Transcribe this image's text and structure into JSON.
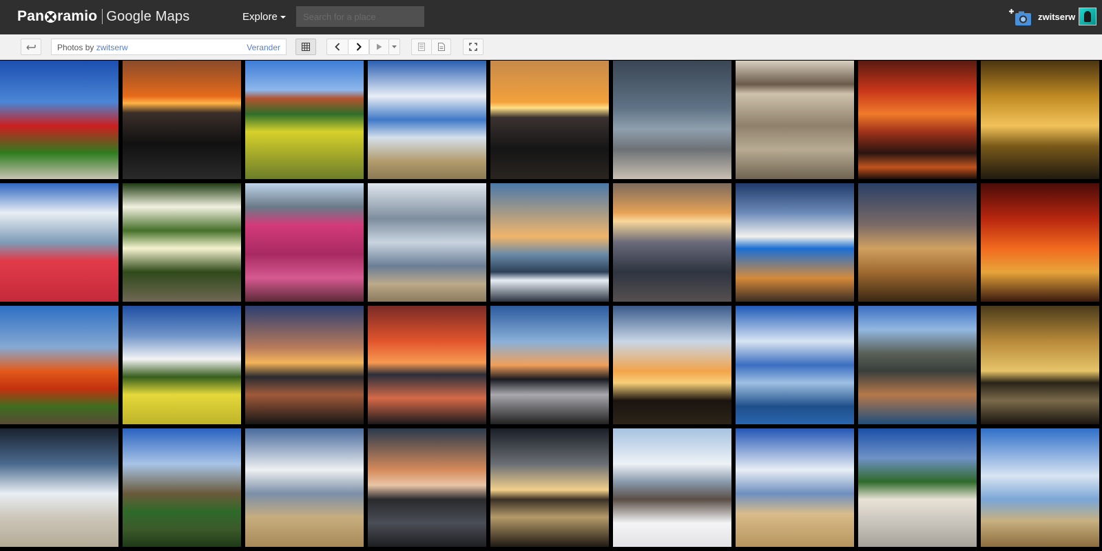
{
  "header": {
    "logo_part1": "Pan",
    "logo_part2": "ramio",
    "logo_maps": "Google Maps",
    "explore_label": "Explore",
    "search_placeholder": "Search for a place",
    "username": "zwitserw",
    "icons": [
      "globe-icon",
      "add-photo-camera-icon",
      "avatar"
    ]
  },
  "toolbar": {
    "back_icon": "back-arrow-icon",
    "photos_by_label": "Photos by",
    "photos_by_user": "zwitserw",
    "change_label": "Verander",
    "buttons": [
      "grid-view-icon",
      "previous-icon",
      "next-icon",
      "play-icon",
      "play-options-icon",
      "list-view-icon",
      "detail-view-icon",
      "fullscreen-icon"
    ]
  },
  "colors": {
    "topbar": "#2f2f2f",
    "toolbar": "#f1f1f1",
    "link": "#5a7ec9",
    "grid_background": "#000000"
  },
  "photos": [
    {
      "bg": "linear-gradient(#1c4fb0 0%, #4b86d6 35%, #cc1f1f 55%, #2e7d1f 78%, #c9c2b3 100%)"
    },
    {
      "bg": "linear-gradient(#8a4b2a 0%, #e66a1a 30%, #ffb347 36%, #3b2f2a 44%, #111 70%, #2a2a2a 100%)"
    },
    {
      "bg": "linear-gradient(#3d7cd6 0%, #8fb7ea 25%, #b3532f 32%, #2f6e2a 45%, #d7d12b 60%, #6c7d2a 100%)"
    },
    {
      "bg": "linear-gradient(#2a5fb0 0%, #e8eef6 30%, #3f78c7 50%, #d5dfe9 65%, #b29c6c 85%, #8c7a54 100%)"
    },
    {
      "bg": "linear-gradient(#c78a4a 0%, #f3a13b 35%, #fde08a 40%, #3a3230 48%, #151515 75%, #2b2520 100%)"
    },
    {
      "bg": "linear-gradient(#3a4654 0%, #5f7386 40%, #8f9fad 58%, #6d7175 75%, #c9c0b2 100%)"
    },
    {
      "bg": "linear-gradient(#d8cfc0 0%, #6a5a4a 20%, #cfc2ad 28%, #8e806b 55%, #b8ab93 75%, #6f6452 100%)"
    },
    {
      "bg": "linear-gradient(#5a1a10 0%, #c8361a 25%, #f07a2a 45%, #a0321a 60%, #2a1510 78%, #c2531e 90%, #1a0f0c 100%)"
    },
    {
      "bg": "linear-gradient(#4a3410 0%, #c08a22 30%, #f2c25a 55%, #7a5a1a 72%, #201a10 100%)"
    },
    {
      "bg": "linear-gradient(#2f67c0 0%, #e8eef4 25%, #7e9cb8 50%, #e23b4a 65%, #c42a3b 100%)"
    },
    {
      "bg": "linear-gradient(#1f3a12 0%, #f1f1df 20%, #46702a 40%, #f6f3d0 55%, #2f4a1a 75%, #706754 100%)"
    },
    {
      "bg": "linear-gradient(#bfd4ea 0%, #6a7a88 20%, #d33b7a 35%, #a82a62 60%, #d55a90 80%, #5b2a38 100%)"
    },
    {
      "bg": "linear-gradient(#dfe6ee 0%, #7e8e9e 30%, #c9d4e0 50%, #6a7e96 70%, #bca98a 85%, #8b7a5c 100%)"
    },
    {
      "bg": "linear-gradient(#4a78a8 0%, #f0b56a 45%, #6a8aa8 60%, #2c4058 75%, #e7eef5 82%, #2b3440 100%)"
    },
    {
      "bg": "linear-gradient(#7c6a5c 0%, #e6a256 25%, #f8d79a 32%, #6a6a7a 50%, #2e3440 75%, #565050 100%)"
    },
    {
      "bg": "linear-gradient(#1f3a6a 0%, #6c8ab8 25%, #f2f2ee 45%, #1b6fd4 55%, #d58a3a 80%, #3b2d24 100%)"
    },
    {
      "bg": "linear-gradient(#2a3f66 0%, #7a6a66 35%, #d0a060 55%, #a06a30 75%, #3a2814 100%)"
    },
    {
      "bg": "linear-gradient(#4a0c08 0%, #b8260f 30%, #f16a1e 55%, #e7a43a 75%, #3a1a10 100%)"
    },
    {
      "bg": "linear-gradient(#2d6fc4 0%, #86a9d2 35%, #e45a1a 55%, #c33210 70%, #3f6e1f 85%, #584a36 100%)"
    },
    {
      "bg": "linear-gradient(#1f4fa4 0%, #6f94c8 25%, #f3f3f3 45%, #365e1c 60%, #e4d83a 75%, #bfb42a 100%)"
    },
    {
      "bg": "linear-gradient(#2c3e70 0%, #b77a5a 35%, #f4b45a 48%, #2a2a30 60%, #a05a3a 75%, #161616 100%)"
    },
    {
      "bg": "linear-gradient(#7a2a26 0%, #e2552c 30%, #f69a52 48%, #2a2e3a 58%, #d66a48 78%, #1c1a1e 100%)"
    },
    {
      "bg": "linear-gradient(#2b5a9e 0%, #8ab0d8 30%, #f0a05a 50%, #1a1a22 62%, #a8a8ae 75%, #222 100%)"
    },
    {
      "bg": "linear-gradient(#3a5a8a 0%, #c8d6e6 30%, #f2a44a 55%, #f7d07a 65%, #1a1410 80%, #2c2418 100%)"
    },
    {
      "bg": "linear-gradient(#1f5ab8 0%, #d8e4f2 30%, #3a6ec0 50%, #9fc0e2 65%, #1e4f8a 85%, #2a66b0 100%)"
    },
    {
      "bg": "linear-gradient(#3b6ec2 0%, #93b8e0 20%, #5a6158 40%, #3a3f3c 55%, #b5784a 75%, #1f4f7e 100%)"
    },
    {
      "bg": "linear-gradient(#4a3a1a 0%, #b88a3a 30%, #e6c46a 55%, #2a2418 65%, #7a6a4a 80%, #1a1510 100%)"
    },
    {
      "bg": "linear-gradient(#1a2230 0%, #4a6a8e 30%, #e9eef3 55%, #cdc7ba 75%, #b4aa96 100%)"
    },
    {
      "bg": "linear-gradient(#2a62c0 0%, #a8c4e6 30%, #6a5a3a 55%, #2e6a2a 70%, #3c5a2a 85%, #1f3a18 100%)"
    },
    {
      "bg": "linear-gradient(#486a9c 0%, #eef0f2 35%, #7b8fa8 55%, #c7ad7e 75%, #a88a58 100%)"
    },
    {
      "bg": "linear-gradient(#2a3a4c 0%, #d58a5a 35%, #e8c6a8 48%, #2a2a2e 60%, #4a4e56 80%, #1e1e22 100%)"
    },
    {
      "bg": "linear-gradient(#1a1e26 0%, #6a6e74 30%, #f2d08a 52%, #3a3024 60%, #b49a6a 75%, #201a14 100%)"
    },
    {
      "bg": "linear-gradient(#a6c2e0 0%, #eef2f6 30%, #8a9aac 45%, #5a4e46 60%, #f4f4f6 80%, #e2e2e6 100%)"
    },
    {
      "bg": "linear-gradient(#2356b4 0%, #e8eef5 35%, #6e8fbf 55%, #d9bc8a 72%, #b7955e 100%)"
    },
    {
      "bg": "linear-gradient(#1a4fa8 0%, #6f92c6 25%, #2f6a2a 45%, #e8e2d6 60%, #c8c3bb 80%, #a7a299 100%)"
    },
    {
      "bg": "linear-gradient(#2f6fc8 0%, #d8e4f2 40%, #7aa6d6 60%, #c8b080 78%, #8c6d3e 100%)"
    }
  ]
}
